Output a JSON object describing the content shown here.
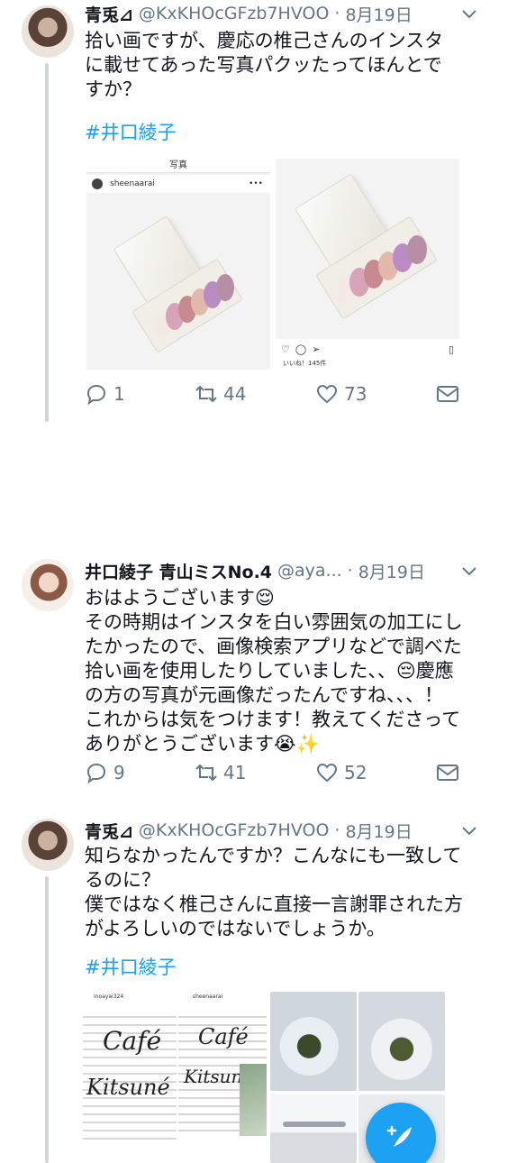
{
  "tweets": [
    {
      "name": "青兎⊿",
      "handle": "@KxKHOcGFzb7HVOO",
      "dot": "·",
      "date": "8月19日",
      "text": "拾い画ですが、慶応の椎己さんのインスタに載せてあった写真パクッたってほんとですか？",
      "hashtag": "#井口綾子",
      "media": {
        "left_topbar": "写真",
        "left_username": "sheenaarai",
        "right_likes": "いいね！145件"
      },
      "replies": "1",
      "retweets": "44",
      "likes": "73"
    },
    {
      "name": "井口綾子 青山ミスNo.4",
      "handle": "@aya...",
      "dot": "·",
      "date": "8月19日",
      "text_lines": [
        "おはようございます😌",
        "その時期はインスタを白い雰囲気の加工にし",
        "たかったので、画像検索アプリなどで調べた",
        "拾い画を使用したりしていました、、😔慶應",
        "の方の写真が元画像だったんですね、、、！",
        "これからは気をつけます！教えてくださって",
        "ありがとうございます😭✨"
      ],
      "replies": "9",
      "retweets": "41",
      "likes": "52"
    },
    {
      "name": "青兎⊿",
      "handle": "@KxKHOcGFzb7HVOO",
      "dot": "·",
      "date": "8月19日",
      "text_lines": [
        "知らなかったんですか？こんなにも一致して",
        "るのに？",
        "僕ではなく椎己さんに直接一言謝罪された方",
        "がよろしいのではないでしょうか。"
      ],
      "hashtag": "#井口綾子",
      "media": {
        "cafe_title": "Café",
        "cafe_sub": "Kitsuné",
        "left_user": "inoayai324",
        "mid_user": "sheenaarai"
      }
    }
  ],
  "fab": {
    "label": "compose-tweet"
  },
  "colors": {
    "link": "#1da1f2",
    "muted": "#657786",
    "thread": "#ccd6dd"
  }
}
